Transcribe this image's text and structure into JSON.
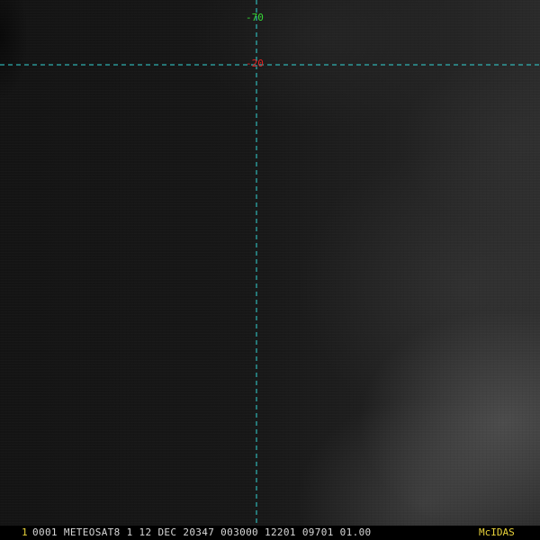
{
  "overlay": {
    "longitude_label": "-70",
    "latitude_label": "-20",
    "colors": {
      "grid": "#33d6d6",
      "longitude_label": "#36d836",
      "latitude_label": "#e02020"
    }
  },
  "status_bar": {
    "frame_number": "1",
    "caption": "0001 METEOSAT8    1 12 DEC 20347 003000 12201 09701 01.00",
    "logo": "McIDAS",
    "colors": {
      "frame_number": "#e8d23a",
      "caption": "#d8d8d8",
      "logo": "#e8d23a"
    }
  }
}
